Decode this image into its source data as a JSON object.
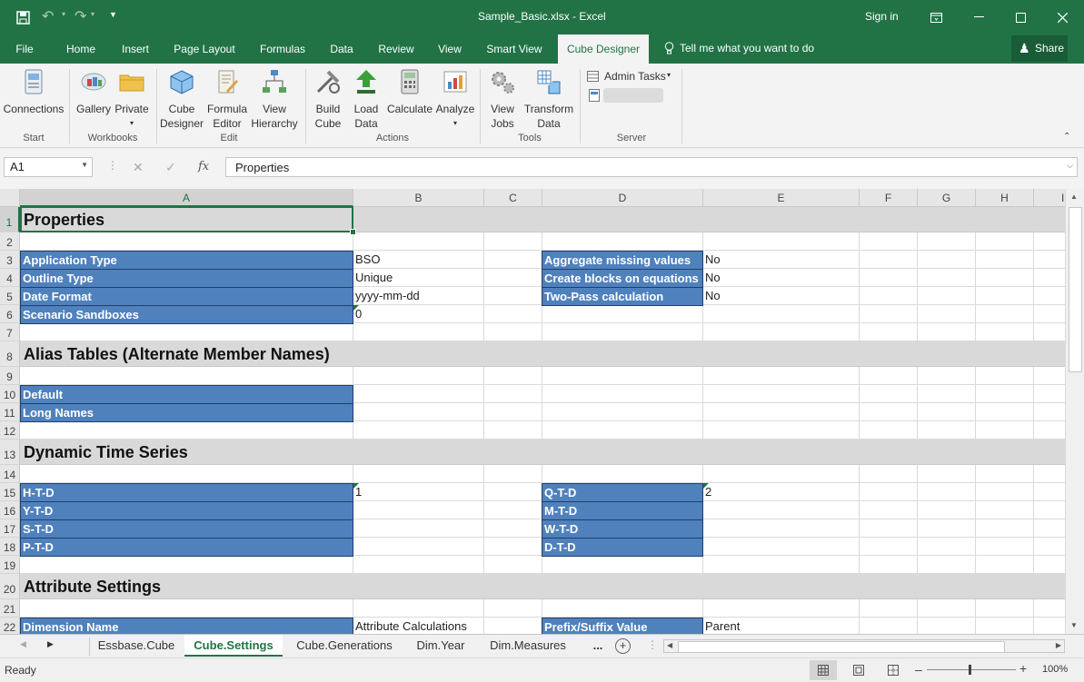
{
  "window": {
    "title": "Sample_Basic.xlsx  -  Excel",
    "sign_in": "Sign in",
    "share": "Share",
    "tell_me": "Tell me what you want to do"
  },
  "tabs": [
    "File",
    "Home",
    "Insert",
    "Page Layout",
    "Formulas",
    "Data",
    "Review",
    "View",
    "Smart View",
    "Cube Designer"
  ],
  "active_tab": "Cube Designer",
  "ribbon": {
    "groups": [
      "Start",
      "Workbooks",
      "Edit",
      "Actions",
      "Tools",
      "Server"
    ],
    "buttons": {
      "connections": "Connections",
      "gallery": "Gallery",
      "private": "Private",
      "cube_designer_1": "Cube",
      "cube_designer_2": "Designer",
      "formula_editor_1": "Formula",
      "formula_editor_2": "Editor",
      "view_hierarchy_1": "View",
      "view_hierarchy_2": "Hierarchy",
      "build_cube_1": "Build",
      "build_cube_2": "Cube",
      "load_data_1": "Load",
      "load_data_2": "Data",
      "calculate": "Calculate",
      "analyze": "Analyze",
      "view_jobs_1": "View",
      "view_jobs_2": "Jobs",
      "transform_data_1": "Transform",
      "transform_data_2": "Data",
      "admin_tasks": "Admin Tasks"
    }
  },
  "formula_bar": {
    "name_box": "A1",
    "fx": "fx",
    "content": "Properties"
  },
  "columns": [
    "A",
    "B",
    "C",
    "D",
    "E",
    "F",
    "G",
    "H",
    "I"
  ],
  "rows": [
    "1",
    "2",
    "3",
    "4",
    "5",
    "6",
    "7",
    "8",
    "9",
    "10",
    "11",
    "12",
    "13",
    "14",
    "15",
    "16",
    "17",
    "18",
    "19",
    "20",
    "21",
    "22"
  ],
  "sections": {
    "properties": "Properties",
    "alias": "Alias Tables (Alternate Member Names)",
    "dts": "Dynamic Time Series",
    "attr": "Attribute Settings"
  },
  "properties": {
    "application_type": {
      "label": "Application Type",
      "value": "BSO"
    },
    "outline_type": {
      "label": "Outline Type",
      "value": "Unique"
    },
    "date_format": {
      "label": "Date Format",
      "value": "yyyy-mm-dd"
    },
    "scenario_sandboxes": {
      "label": "Scenario Sandboxes",
      "value": "0"
    },
    "aggregate_missing": {
      "label": "Aggregate missing values",
      "value": "No"
    },
    "create_blocks": {
      "label": "Create blocks on equations",
      "value": "No"
    },
    "two_pass": {
      "label": "Two-Pass calculation",
      "value": "No"
    }
  },
  "alias_tables": [
    "Default",
    "Long Names"
  ],
  "dts": {
    "htd": {
      "label": "H-T-D",
      "value": "1"
    },
    "ytd": "Y-T-D",
    "std": "S-T-D",
    "ptd": "P-T-D",
    "qtd": {
      "label": "Q-T-D",
      "value": "2"
    },
    "mtd": "M-T-D",
    "wtd": "W-T-D",
    "dtd": "D-T-D"
  },
  "attr": {
    "dimension_name": "Dimension Name",
    "attribute_calculations": "Attribute Calculations",
    "prefix_suffix": "Prefix/Suffix Value",
    "parent": "Parent"
  },
  "sheets": [
    "Essbase.Cube",
    "Cube.Settings",
    "Cube.Generations",
    "Dim.Year",
    "Dim.Measures",
    "..."
  ],
  "active_sheet": "Cube.Settings",
  "status": {
    "ready": "Ready",
    "zoom": "100%"
  },
  "colors": {
    "excel_green": "#217346",
    "label_blue": "#4f81bd",
    "band_gray": "#d9d9d9"
  }
}
